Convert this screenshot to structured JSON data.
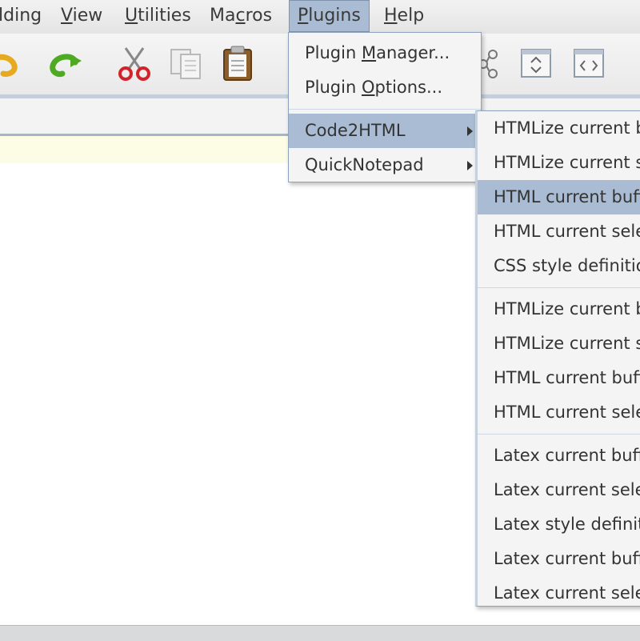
{
  "menubar": {
    "items": [
      {
        "label_pre": "",
        "label_ul": "",
        "label_post": "lding"
      },
      {
        "label_pre": "",
        "label_ul": "V",
        "label_post": "iew"
      },
      {
        "label_pre": "",
        "label_ul": "U",
        "label_post": "tilities"
      },
      {
        "label_pre": "Ma",
        "label_ul": "c",
        "label_post": "ros"
      },
      {
        "label_pre": "",
        "label_ul": "P",
        "label_post": "lugins"
      },
      {
        "label_pre": "",
        "label_ul": "H",
        "label_post": "elp"
      }
    ]
  },
  "toolbar": {
    "icons": [
      "undo-icon",
      "redo-icon",
      "cut-icon",
      "copy-icon",
      "paste-icon",
      "share-icon",
      "fold-icon",
      "tag-icon"
    ]
  },
  "plugins_menu": {
    "manager": {
      "pre": "Plugin ",
      "ul": "M",
      "post": "anager..."
    },
    "options": {
      "pre": "Plugin ",
      "ul": "O",
      "post": "ptions..."
    },
    "code2html": "Code2HTML",
    "quicknotepad": "QuickNotepad"
  },
  "code2html_menu": {
    "group1": [
      "HTMLize current b",
      "HTMLize current s",
      "HTML current buff",
      "HTML current sele",
      "CSS style definitio"
    ],
    "group2": [
      "HTMLize current b",
      "HTMLize current s",
      "HTML current buff",
      "HTML current sele"
    ],
    "group3": [
      "Latex current buff",
      "Latex current sele",
      "Latex style definiti",
      "Latex current buff",
      "Latex current sele"
    ]
  },
  "colors": {
    "highlight": "#a9bcd3",
    "menu_border": "#8ea2bf"
  }
}
